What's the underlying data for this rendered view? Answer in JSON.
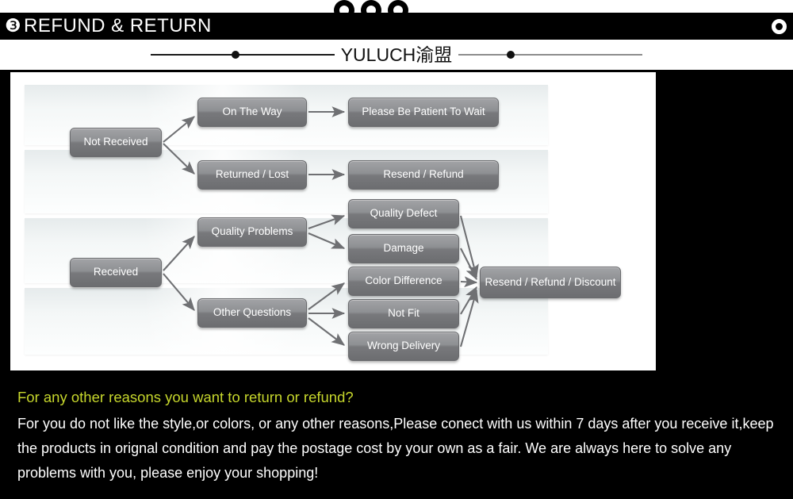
{
  "header": {
    "section_number": "❸",
    "title": "REFUND & RETURN",
    "ring_icon": "ring-icon",
    "punch_icons": [
      "punch-hole-icon",
      "punch-hole-icon",
      "punch-hole-icon"
    ]
  },
  "brand": {
    "name": "YULUCH渝盟"
  },
  "flowchart": {
    "title": "Refund and return decision flow",
    "nodes": [
      {
        "id": "not-received",
        "label": "Not Received"
      },
      {
        "id": "on-the-way",
        "label": "On The Way"
      },
      {
        "id": "returned-lost",
        "label": "Returned / Lost"
      },
      {
        "id": "be-patient",
        "label": "Please Be Patient To Wait"
      },
      {
        "id": "resend-refund",
        "label": "Resend / Refund"
      },
      {
        "id": "received",
        "label": "Received"
      },
      {
        "id": "quality-problems",
        "label": "Quality Problems"
      },
      {
        "id": "other-questions",
        "label": "Other Questions"
      },
      {
        "id": "quality-defect",
        "label": "Quality Defect"
      },
      {
        "id": "damage",
        "label": "Damage"
      },
      {
        "id": "color-difference",
        "label": "Color Difference"
      },
      {
        "id": "not-fit",
        "label": "Not Fit"
      },
      {
        "id": "wrong-delivery",
        "label": "Wrong Delivery"
      },
      {
        "id": "resend-refund-discount",
        "label": "Resend / Refund / Discount"
      }
    ],
    "edges": [
      {
        "from": "not-received",
        "to": "on-the-way"
      },
      {
        "from": "not-received",
        "to": "returned-lost"
      },
      {
        "from": "on-the-way",
        "to": "be-patient"
      },
      {
        "from": "returned-lost",
        "to": "resend-refund"
      },
      {
        "from": "received",
        "to": "quality-problems"
      },
      {
        "from": "received",
        "to": "other-questions"
      },
      {
        "from": "quality-problems",
        "to": "quality-defect"
      },
      {
        "from": "quality-problems",
        "to": "damage"
      },
      {
        "from": "other-questions",
        "to": "color-difference"
      },
      {
        "from": "other-questions",
        "to": "not-fit"
      },
      {
        "from": "other-questions",
        "to": "wrong-delivery"
      },
      {
        "from": "quality-defect",
        "to": "resend-refund-discount"
      },
      {
        "from": "damage",
        "to": "resend-refund-discount"
      },
      {
        "from": "color-difference",
        "to": "resend-refund-discount"
      },
      {
        "from": "not-fit",
        "to": "resend-refund-discount"
      },
      {
        "from": "wrong-delivery",
        "to": "resend-refund-discount"
      }
    ]
  },
  "policy": {
    "heading": "For any other reasons you want to return or refund?",
    "body": "For you do not like the style,or colors, or any other reasons,Please conect with us within 7 days after you receive it,keep the products in orignal condition and pay the postage cost by your own as a fair. We are always here to solve any problems with you, please enjoy your shopping!"
  },
  "colors": {
    "header_bg": "#000000",
    "header_text": "#ffffff",
    "panel_bg": "#ffffff",
    "panel_border": "#000000",
    "box_gradient_top": "#a2a3a6",
    "box_gradient_bottom": "#6c6d70",
    "box_text": "#ffffff",
    "arrow": "#6f7073",
    "policy_heading": "#c6d62c",
    "policy_body": "#ffffff"
  }
}
